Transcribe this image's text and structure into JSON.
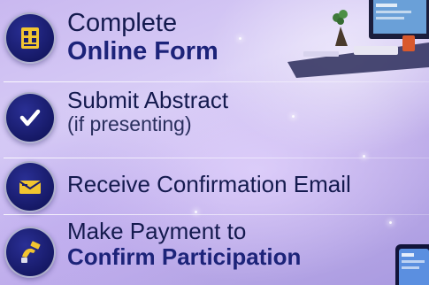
{
  "steps": [
    {
      "icon": "form-grid-icon",
      "line1": "Complete",
      "line2": "Online Form"
    },
    {
      "icon": "checkmark-icon",
      "line1": "Submit Abstract",
      "line2": "(if presenting)"
    },
    {
      "icon": "envelope-icon",
      "line1": "Receive Confirmation Email"
    },
    {
      "icon": "payment-hand-icon",
      "line1": "Make Payment to",
      "line2": "Confirm Participation"
    }
  ],
  "colors": {
    "icon_bg": "#1a1d6e",
    "text_dark": "#141a4e",
    "text_bold": "#1c2379"
  }
}
